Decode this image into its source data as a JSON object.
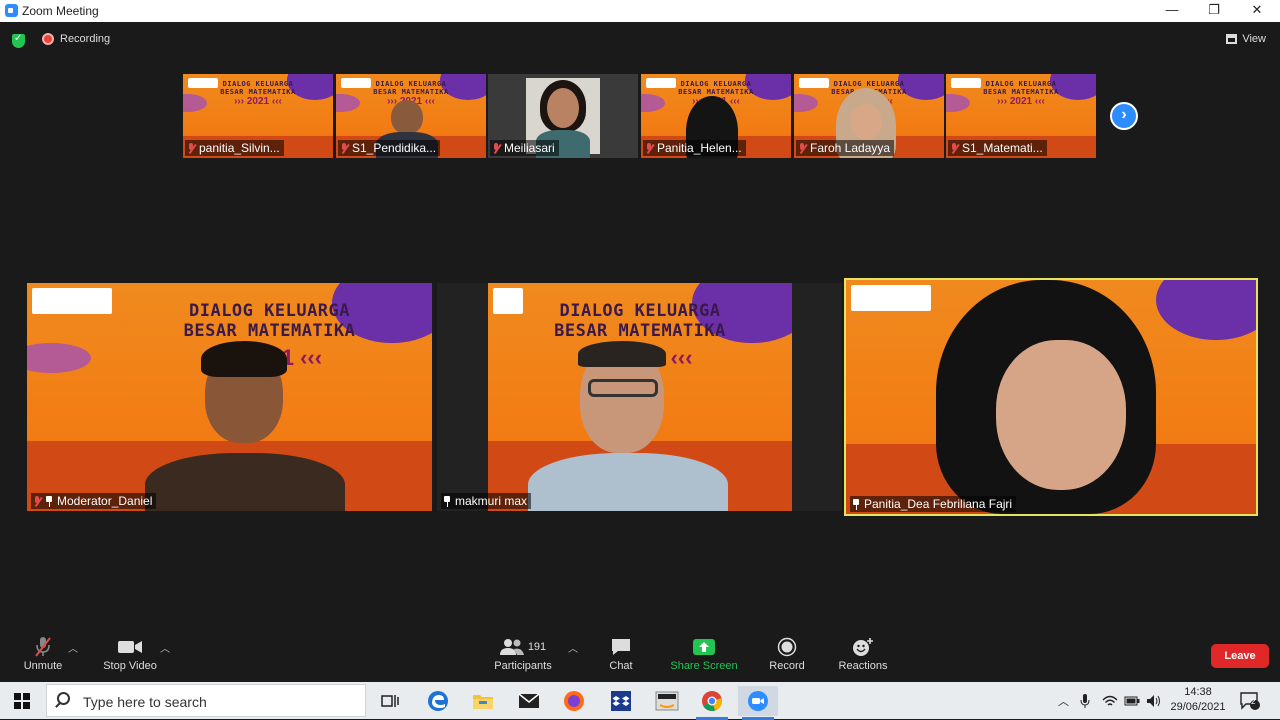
{
  "window": {
    "title": "Zoom Meeting"
  },
  "window_controls": {
    "minimize": "—",
    "restore": "❐",
    "close": "✕"
  },
  "meeting_header": {
    "recording_label": "Recording",
    "view_label": "View"
  },
  "banner": {
    "line1": "DIALOG KELUARGA",
    "line2": "BESAR MATEMATIKA",
    "arrows": "›››  2021  ‹‹‹",
    "year": "2021"
  },
  "gallery_strip": [
    {
      "name": "panitia_Silvin...",
      "muted": true
    },
    {
      "name": "S1_Pendidika...",
      "muted": true
    },
    {
      "name": "Meiliasari",
      "muted": true
    },
    {
      "name": "Panitia_Helen...",
      "muted": true
    },
    {
      "name": "Faroh Ladayya",
      "muted": true
    },
    {
      "name": "S1_Matemati...",
      "muted": true
    }
  ],
  "speakers": [
    {
      "name": "Moderator_Daniel",
      "muted": true,
      "pinned": true
    },
    {
      "name": "makmuri max",
      "muted": false,
      "pinned": true
    },
    {
      "name": "Panitia_Dea Febriliana Fajri",
      "muted": false,
      "pinned": true,
      "active": true
    }
  ],
  "toolbar": {
    "unmute": "Unmute",
    "stop_video": "Stop Video",
    "participants": "Participants",
    "participants_count": "191",
    "chat": "Chat",
    "share_screen": "Share Screen",
    "record": "Record",
    "reactions": "Reactions",
    "leave": "Leave"
  },
  "taskbar": {
    "search_placeholder": "Type here to search",
    "time": "14:38",
    "date": "29/06/2021",
    "notification_count": "2"
  },
  "colors": {
    "accent": "#2d8cff",
    "share_green": "#23c552",
    "leave_red": "#e02828",
    "active_outline": "#e7e35e",
    "banner_orange": "#f27b13"
  }
}
